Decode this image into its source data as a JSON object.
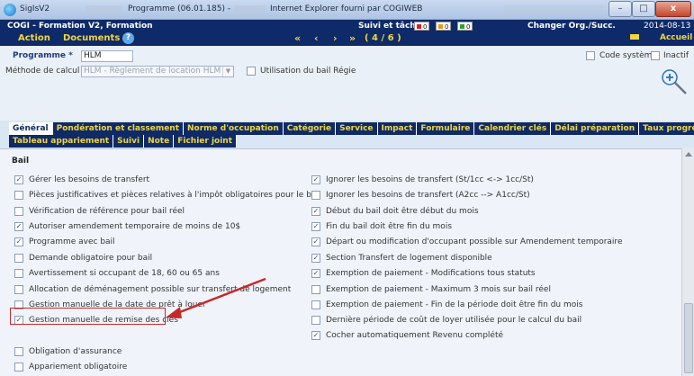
{
  "window": {
    "title_app": "SigIsV2",
    "title_program": "Programme (06.01.185) -",
    "title_browser": "Internet Explorer fourni par COGIWEB",
    "btn_min": "–",
    "btn_max": "□",
    "btn_close": "x"
  },
  "appbar": {
    "title": "COGI - Formation V2, Formation",
    "menu_action": "Action",
    "menu_documents": "Documents",
    "help": "?",
    "suivi_label": "Suivi et tâche",
    "badges": [
      "0",
      "0",
      "0"
    ],
    "nav_first": "«",
    "nav_prev": "‹",
    "nav_next": "›",
    "nav_last": "»",
    "record": "( 4 / 6 )",
    "org_label": "Changer Org./Succ.",
    "date": "2014-08-13",
    "accueil": "Accueil"
  },
  "form": {
    "programme_label": "Programme *",
    "programme_value": "HLM",
    "methode_label": "Méthode de calcul",
    "methode_value": "HLM - Règlement de location HLM",
    "regie_label": "Utilisation du bail Régie",
    "codesys_label": "Code système",
    "inactif_label": "Inactif"
  },
  "tabs": {
    "row1": [
      "Général",
      "Pondération et classement",
      "Norme d'occupation",
      "Catégorie",
      "Service",
      "Impact",
      "Formulaire",
      "Calendrier clés",
      "Délai préparation",
      "Taux progressif"
    ],
    "row2": [
      "Tableau appariement",
      "Suivi",
      "Note",
      "Fichier joint"
    ],
    "active": "Général"
  },
  "section": {
    "title": "Bail",
    "left": [
      {
        "label": "Gérer les besoins de transfert",
        "checked": true
      },
      {
        "label": "Pièces justificatives et pièces relatives à l'impôt obligatoires pour le bail",
        "checked": false
      },
      {
        "label": "Vérification de référence pour bail réel",
        "checked": false
      },
      {
        "label": "Autoriser amendement temporaire de moins de 10$",
        "checked": true
      },
      {
        "label": "Programme avec bail",
        "checked": true
      },
      {
        "label": "Demande obligatoire pour bail",
        "checked": false
      },
      {
        "label": "Avertissement si occupant de 18, 60 ou 65 ans",
        "checked": false
      },
      {
        "label": "Allocation de déménagement possible sur transfert de logement",
        "checked": false
      },
      {
        "label": "Gestion manuelle de la date de prêt à louer",
        "checked": false
      },
      {
        "label": "Gestion manuelle de remise des clés",
        "checked": true
      },
      {
        "label": "Obligation d'assurance",
        "checked": false
      },
      {
        "label": "Appariement obligatoire",
        "checked": false
      }
    ],
    "right": [
      {
        "label": "Ignorer les besoins de transfert (St/1cc <-> 1cc/St)",
        "checked": true
      },
      {
        "label": "Ignorer les besoins de transfert (A2cc --> A1cc/St)",
        "checked": false
      },
      {
        "label": "Début du bail doit être début du mois",
        "checked": true
      },
      {
        "label": "Fin du bail doit être fin du mois",
        "checked": true
      },
      {
        "label": "Départ ou modification d'occupant possible sur Amendement temporaire",
        "checked": true
      },
      {
        "label": "Section Transfert de logement disponible",
        "checked": true
      },
      {
        "label": "Exemption de paiement - Modifications tous statuts",
        "checked": true
      },
      {
        "label": "Exemption de paiement - Maximum 3 mois sur bail réel",
        "checked": false
      },
      {
        "label": "Exemption de paiement - Fin de la période doit être fin du mois",
        "checked": false
      },
      {
        "label": "Dernière période de coût de loyer utilisée pour le calcul du bail",
        "checked": false
      },
      {
        "label": "Cocher automatiquement Revenu complété",
        "checked": true
      }
    ]
  },
  "colors": {
    "navy": "#0e2a68",
    "yellow": "#f2d73c",
    "highlight": "#c62828"
  }
}
